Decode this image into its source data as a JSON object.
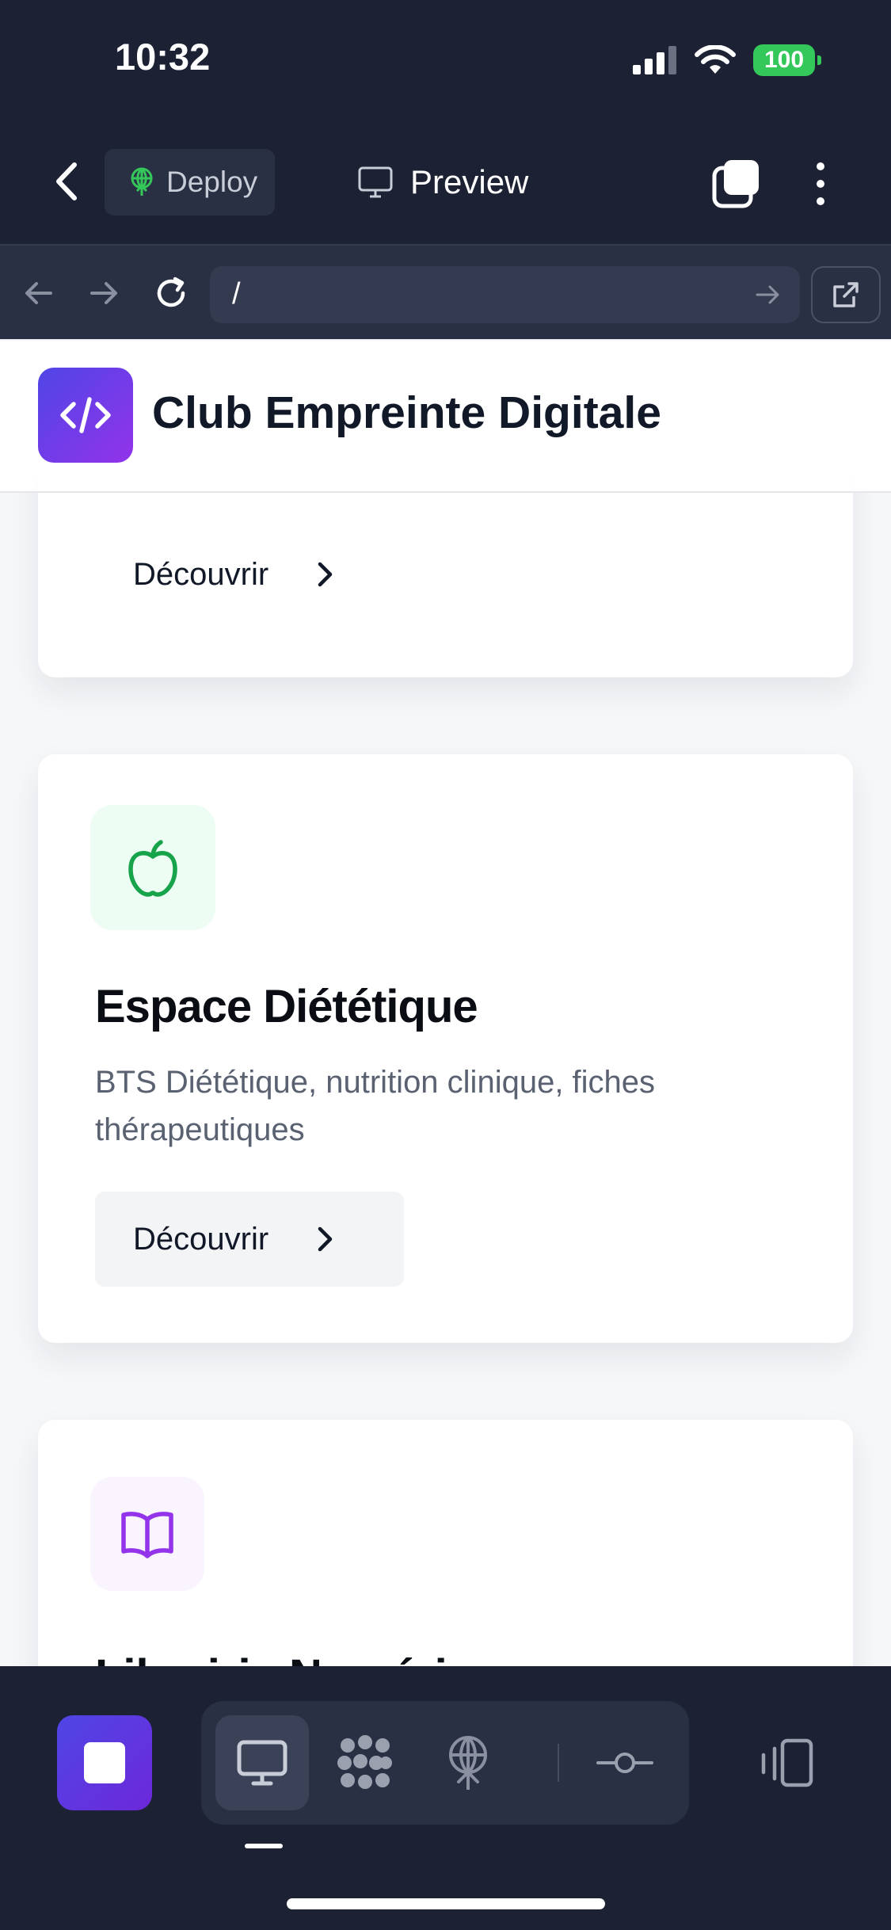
{
  "status_bar": {
    "time": "10:32",
    "battery": "100"
  },
  "nav": {
    "deploy_label": "Deploy",
    "preview_label": "Preview"
  },
  "url_bar": {
    "value": "/"
  },
  "site": {
    "title": "Club Empreinte Digitale"
  },
  "cards": [
    {
      "button_label": "Découvrir"
    },
    {
      "icon": "apple-icon",
      "title": "Espace Diététique",
      "description": "BTS Diététique, nutrition clinique, fiches thérapeutiques",
      "button_label": "Découvrir"
    },
    {
      "icon": "book-icon",
      "title": "Librairie Numérique"
    }
  ],
  "toolbar": {
    "items": [
      "stop",
      "desktop-preview",
      "network",
      "deploy",
      "git-commit",
      "device-switch"
    ]
  },
  "colors": {
    "chrome_bg": "#1c2133",
    "accent": "#4f46e5",
    "apple_green": "#16a34a",
    "book_purple": "#9333ea",
    "battery_green": "#34c759"
  }
}
